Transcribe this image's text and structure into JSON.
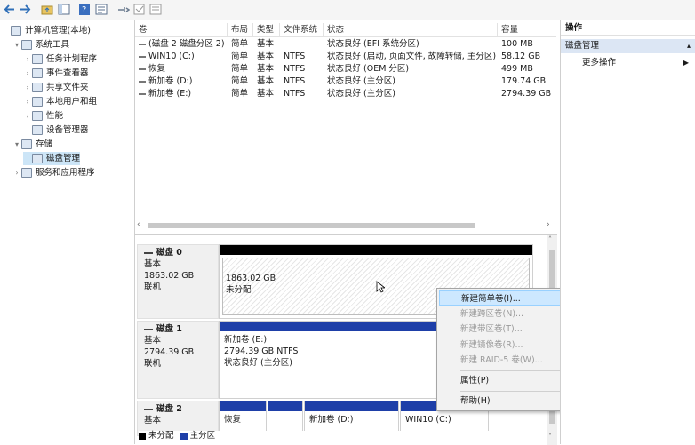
{
  "toolbar": {
    "icons": [
      "back-icon",
      "forward-icon",
      "up-folder-icon",
      "show-hide-tree-icon",
      "help-icon",
      "properties-icon",
      "connect-icon",
      "check-icon",
      "view-icon"
    ]
  },
  "tree": {
    "items": [
      {
        "label": "计算机管理(本地)",
        "level": 0,
        "arrow": ""
      },
      {
        "label": "系统工具",
        "level": 1,
        "arrow": "▾"
      },
      {
        "label": "任务计划程序",
        "level": 2,
        "arrow": "›"
      },
      {
        "label": "事件查看器",
        "level": 2,
        "arrow": "›"
      },
      {
        "label": "共享文件夹",
        "level": 2,
        "arrow": "›"
      },
      {
        "label": "本地用户和组",
        "level": 2,
        "arrow": "›"
      },
      {
        "label": "性能",
        "level": 2,
        "arrow": "›"
      },
      {
        "label": "设备管理器",
        "level": 2,
        "arrow": ""
      },
      {
        "label": "存储",
        "level": 1,
        "arrow": "▾"
      },
      {
        "label": "磁盘管理",
        "level": 2,
        "arrow": "",
        "selected": true
      },
      {
        "label": "服务和应用程序",
        "level": 1,
        "arrow": "›"
      }
    ]
  },
  "volumes": {
    "columns": [
      "卷",
      "布局",
      "类型",
      "文件系统",
      "状态",
      "容量"
    ],
    "rows": [
      {
        "name": "(磁盘 2 磁盘分区 2)",
        "layout": "简单",
        "type": "基本",
        "fs": "",
        "status": "状态良好 (EFI 系统分区)",
        "cap": "100 MB"
      },
      {
        "name": "WIN10 (C:)",
        "layout": "简单",
        "type": "基本",
        "fs": "NTFS",
        "status": "状态良好 (启动, 页面文件, 故障转储, 主分区)",
        "cap": "58.12 GB"
      },
      {
        "name": "恢复",
        "layout": "简单",
        "type": "基本",
        "fs": "NTFS",
        "status": "状态良好 (OEM 分区)",
        "cap": "499 MB"
      },
      {
        "name": "新加卷 (D:)",
        "layout": "简单",
        "type": "基本",
        "fs": "NTFS",
        "status": "状态良好 (主分区)",
        "cap": "179.74 GB"
      },
      {
        "name": "新加卷 (E:)",
        "layout": "简单",
        "type": "基本",
        "fs": "NTFS",
        "status": "状态良好 (主分区)",
        "cap": "2794.39 GB"
      }
    ]
  },
  "disks": [
    {
      "name": "磁盘 0",
      "type": "基本",
      "size": "1863.02 GB",
      "state": "联机"
    },
    {
      "name": "磁盘 1",
      "type": "基本",
      "size": "2794.39 GB",
      "state": "联机"
    },
    {
      "name": "磁盘 2",
      "type": "基本"
    }
  ],
  "disk0_part": {
    "size": "1863.02 GB",
    "status": "未分配"
  },
  "disk1_part": {
    "name": "新加卷 (E:)",
    "size": "2794.39 GB NTFS",
    "status": "状态良好 (主分区)"
  },
  "disk2_parts": [
    {
      "name": "恢复"
    },
    {
      "name": ""
    },
    {
      "name": "新加卷 (D:)"
    },
    {
      "name": "WIN10 (C:)"
    }
  ],
  "legend": {
    "unallocated": "未分配",
    "primary": "主分区"
  },
  "context_menu": {
    "items": [
      {
        "label": "新建简单卷(I)...",
        "disabled": false,
        "highlighted": true
      },
      {
        "label": "新建跨区卷(N)...",
        "disabled": true
      },
      {
        "label": "新建带区卷(T)...",
        "disabled": true
      },
      {
        "label": "新建镜像卷(R)...",
        "disabled": true
      },
      {
        "label": "新建 RAID-5 卷(W)...",
        "disabled": true
      },
      {
        "label": "属性(P)",
        "disabled": false
      },
      {
        "label": "帮助(H)",
        "disabled": false
      }
    ]
  },
  "actions": {
    "header": "操作",
    "section": "磁盘管理",
    "more": "更多操作"
  },
  "colors": {
    "primary": "#1e3fa8",
    "black": "#000000",
    "highlight": "#cde8ff",
    "tree_selected": "#cce5f7"
  }
}
